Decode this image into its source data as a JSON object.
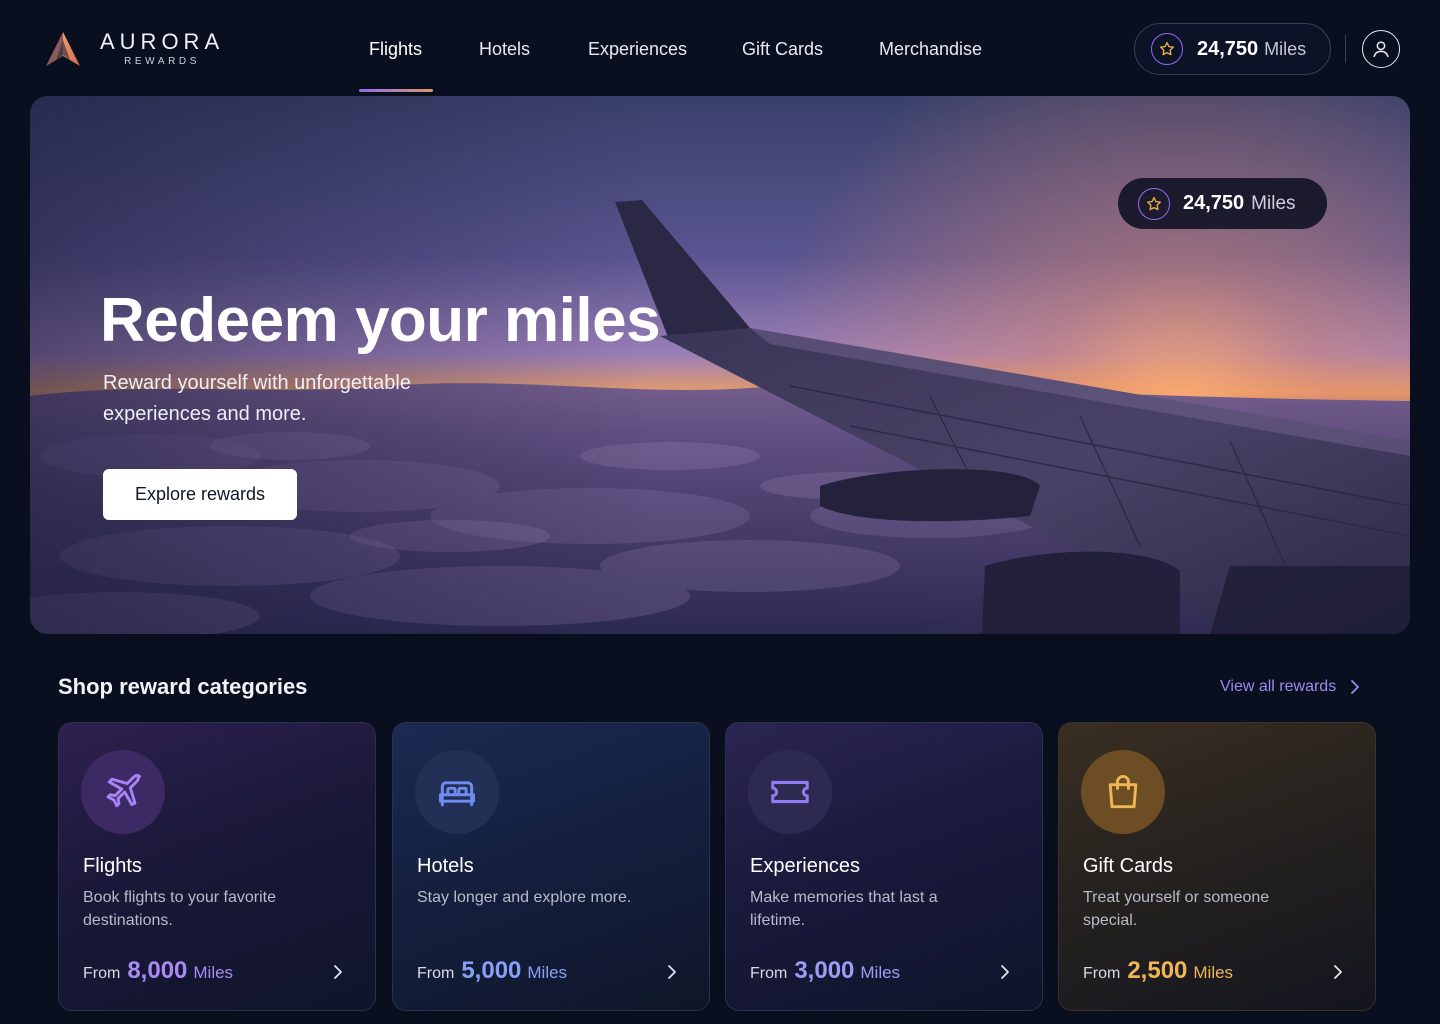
{
  "brand": {
    "name": "AURORA",
    "sub": "REWARDS"
  },
  "nav": {
    "items": [
      {
        "label": "Flights",
        "active": true
      },
      {
        "label": "Hotels",
        "active": false
      },
      {
        "label": "Experiences",
        "active": false
      },
      {
        "label": "Gift Cards",
        "active": false
      },
      {
        "label": "Merchandise",
        "active": false
      }
    ]
  },
  "account": {
    "miles_value": "24,750",
    "miles_unit": "Miles",
    "icons": [
      "star-icon",
      "user-icon"
    ]
  },
  "hero": {
    "title": "Redeem your miles",
    "subtitle": "Reward yourself with unforgettable experiences and more.",
    "cta_label": "Explore rewards",
    "miles_value": "24,750",
    "miles_unit": "Miles"
  },
  "categories": {
    "title": "Shop reward categories",
    "view_all_label": "View all rewards",
    "items": [
      {
        "title": "Flights",
        "desc": "Book flights to your favorite destinations.",
        "from": "From",
        "amount": "8,000",
        "unit": "Miles",
        "icon": "plane-icon"
      },
      {
        "title": "Hotels",
        "desc": "Stay longer and explore more.",
        "from": "From",
        "amount": "5,000",
        "unit": "Miles",
        "icon": "bed-icon"
      },
      {
        "title": "Experiences",
        "desc": "Make memories that last a lifetime.",
        "from": "From",
        "amount": "3,000",
        "unit": "Miles",
        "icon": "ticket-icon"
      },
      {
        "title": "Gift Cards",
        "desc": "Treat yourself or someone special.",
        "from": "From",
        "amount": "2,500",
        "unit": "Miles",
        "icon": "shopping-bag-icon"
      }
    ]
  },
  "colors": {
    "background": "#0a0f1f",
    "accent_purple": "#8e6cf0",
    "accent_gold": "#f0b555",
    "link": "#9c8af0"
  }
}
